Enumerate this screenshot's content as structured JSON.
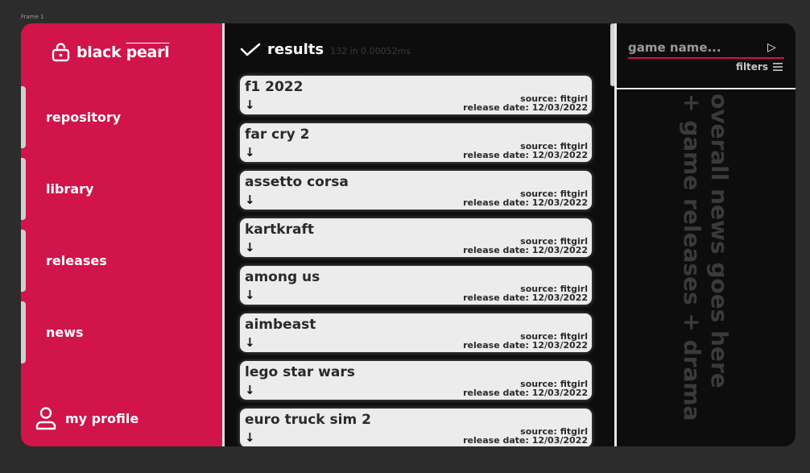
{
  "frame_label": "Frame 1",
  "brand": {
    "name_start": "black ",
    "name_end": "pearl"
  },
  "nav": {
    "items": [
      {
        "label": "repository"
      },
      {
        "label": "library"
      },
      {
        "label": "releases"
      },
      {
        "label": "news"
      }
    ],
    "profile_label": "my profile"
  },
  "results": {
    "title": "results",
    "meta": "132 in 0.00052ms",
    "items": [
      {
        "title": "f1 2022",
        "source": "source: fitgirl",
        "date": "release date: 12/03/2022"
      },
      {
        "title": "far cry 2",
        "source": "source: fitgirl",
        "date": "release date: 12/03/2022"
      },
      {
        "title": "assetto corsa",
        "source": "source: fitgirl",
        "date": "release date: 12/03/2022"
      },
      {
        "title": "kartkraft",
        "source": "source: fitgirl",
        "date": "release date: 12/03/2022"
      },
      {
        "title": "among us",
        "source": "source: fitgirl",
        "date": "release date: 12/03/2022"
      },
      {
        "title": "aimbeast",
        "source": "source: fitgirl",
        "date": "release date: 12/03/2022"
      },
      {
        "title": "lego star wars",
        "source": "source: fitgirl",
        "date": "release date: 12/03/2022"
      },
      {
        "title": "euro truck sim 2",
        "source": "source: fitgirl",
        "date": "release date: 12/03/2022"
      }
    ]
  },
  "search": {
    "placeholder": "game name...",
    "value": "",
    "filters_label": "filters"
  },
  "news": {
    "line1": "overall news goes here",
    "line2": "+ game releases + drama"
  },
  "colors": {
    "accent": "#d1144a",
    "background": "#0d0d0d",
    "card": "#ececec"
  },
  "icons": {
    "brand": "lock-icon",
    "results": "check-icon",
    "download": "arrow-down-icon",
    "submit": "play-icon",
    "filters": "menu-icon",
    "profile": "user-icon"
  }
}
